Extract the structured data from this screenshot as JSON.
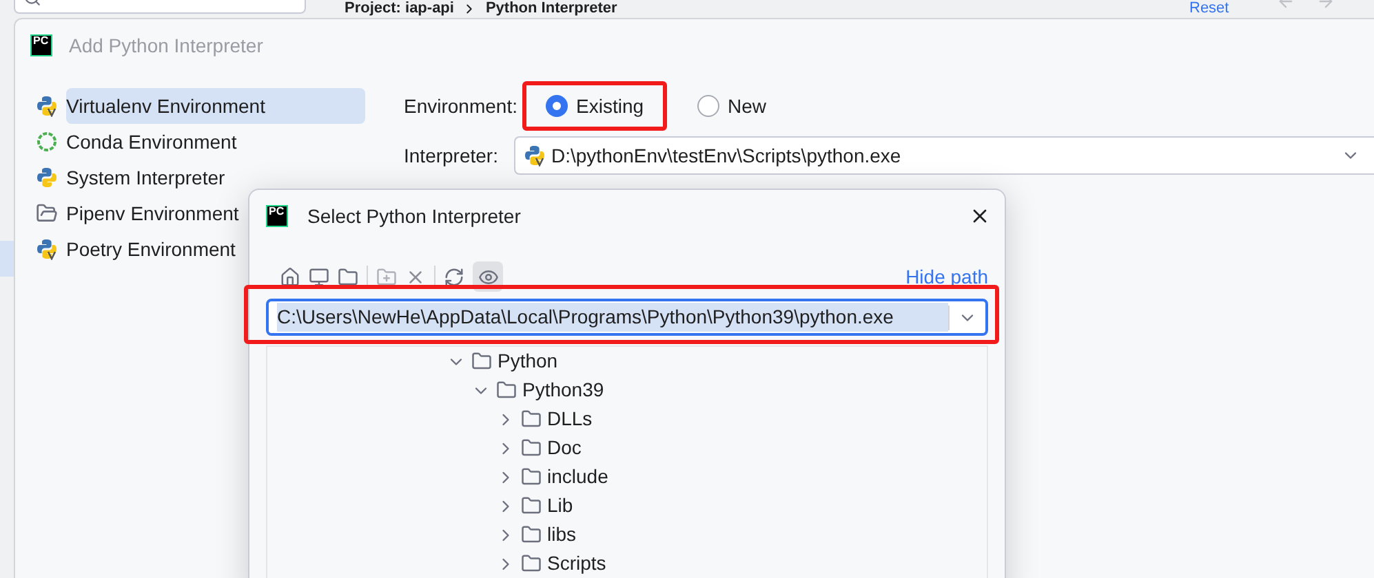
{
  "top_bar": {
    "breadcrumb": [
      "Project: iap-api",
      "Python Interpreter"
    ],
    "reset": "Reset"
  },
  "dialog": {
    "logo": "PC",
    "title": "Add Python Interpreter",
    "sidebar": [
      {
        "label": "Virtualenv Environment",
        "kind": "virtualenv",
        "selected": true
      },
      {
        "label": "Conda Environment",
        "kind": "conda",
        "selected": false
      },
      {
        "label": "System Interpreter",
        "kind": "system",
        "selected": false
      },
      {
        "label": "Pipenv Environment",
        "kind": "pipenv",
        "selected": false
      },
      {
        "label": "Poetry Environment",
        "kind": "poetry",
        "selected": false
      }
    ],
    "environment": {
      "label": "Environment:",
      "options": [
        {
          "label": "Existing",
          "selected": true,
          "highlighted": true
        },
        {
          "label": "New",
          "selected": false,
          "highlighted": false
        }
      ]
    },
    "interpreter": {
      "label": "Interpreter:",
      "value": "D:\\pythonEnv\\testEnv\\Scripts\\python.exe"
    }
  },
  "picker": {
    "logo": "PC",
    "title": "Select Python Interpreter",
    "hide_path": "Hide path",
    "path": {
      "value": "C:\\Users\\NewHe\\AppData\\Local\\Programs\\Python\\Python39\\python.exe",
      "highlighted": true
    },
    "tree": [
      {
        "label": "Python",
        "expanded": true,
        "children": [
          {
            "label": "Python39",
            "expanded": true,
            "children": [
              {
                "label": "DLLs",
                "expanded": false
              },
              {
                "label": "Doc",
                "expanded": false
              },
              {
                "label": "include",
                "expanded": false
              },
              {
                "label": "Lib",
                "expanded": false
              },
              {
                "label": "libs",
                "expanded": false
              },
              {
                "label": "Scripts",
                "expanded": false
              }
            ]
          }
        ]
      }
    ]
  }
}
